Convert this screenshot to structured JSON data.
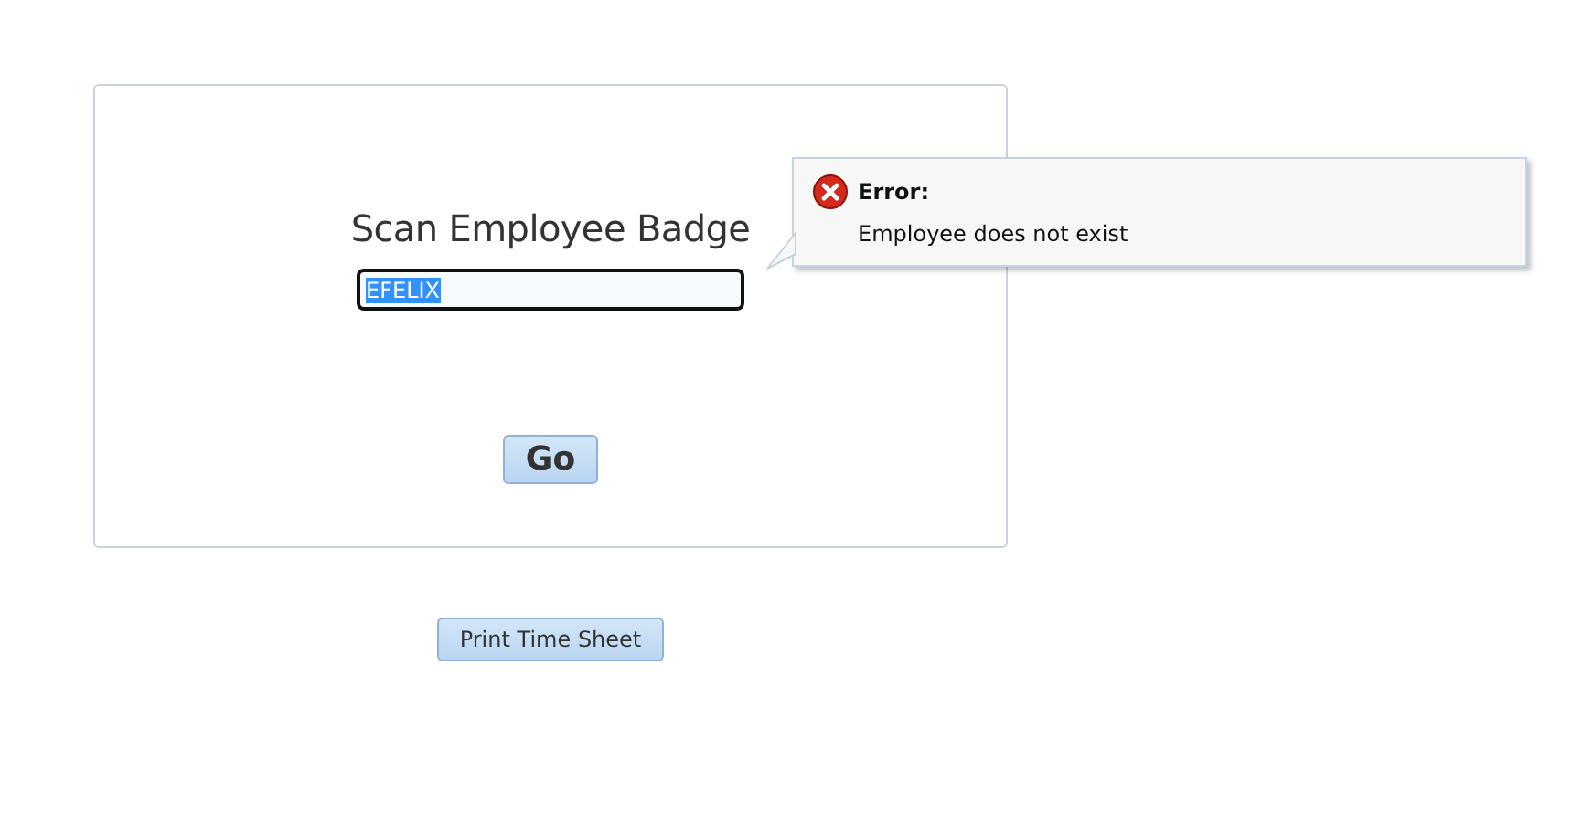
{
  "badge_form": {
    "title": "Scan Employee Badge",
    "badge_field": {
      "value": "EFELIX",
      "value_selected": true
    },
    "go_button": "Go"
  },
  "error_tooltip": {
    "title": "Error:",
    "message": "Employee does not exist"
  },
  "print_button": "Print Time Sheet"
}
